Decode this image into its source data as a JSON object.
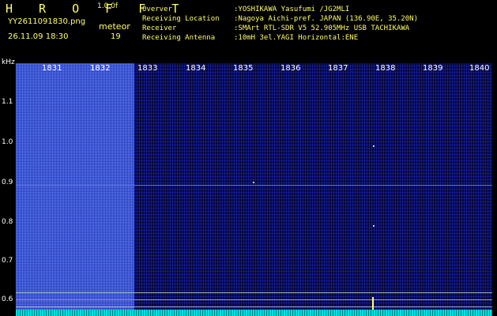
{
  "header": {
    "app_title": "H R O F F T",
    "version": "1.0.0f",
    "filename": "YY2611091830.png",
    "datetime": "26.11.09 18:30",
    "meteor_label": "meteor",
    "meteor_count": "19"
  },
  "info": [
    {
      "key": "Overver",
      "value": ":YOSHIKAWA Yasufumi /JG2MLI"
    },
    {
      "key": "Receiving Location",
      "value": ":Nagoya Aichi-pref. JAPAN (136.90E, 35.20N)"
    },
    {
      "key": "Receiver",
      "value": ":SMArt RTL-SDR V5 52.905MHz USB TACHIKAWA"
    },
    {
      "key": "Receiving Antenna",
      "value": ":10mH 3el.YAGI Horizontal:ENE"
    }
  ],
  "spectrogram": {
    "unit": "kHz",
    "time_ticks": [
      "1831",
      "1832",
      "1833",
      "1834",
      "1835",
      "1836",
      "1837",
      "1838",
      "1839",
      "1840"
    ],
    "freq_ticks": [
      "1.1",
      "1.0",
      "0.9",
      "0.8",
      "0.7",
      "0.6"
    ]
  },
  "colors": {
    "label": "#ffff66",
    "background": "#000000",
    "noise": "#1a2aa8",
    "baseline": "#00e0e0"
  }
}
